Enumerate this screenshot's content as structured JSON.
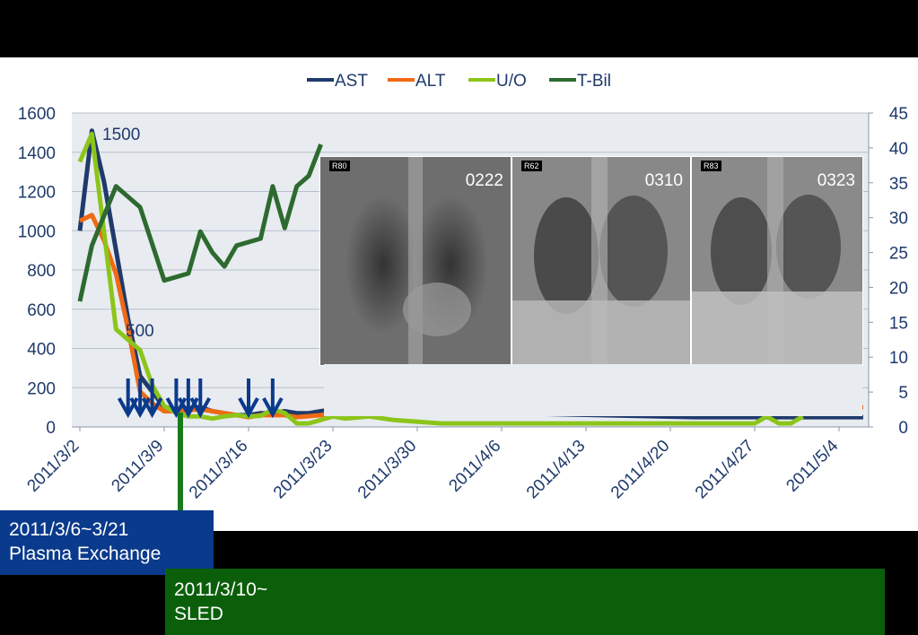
{
  "chart_data": {
    "type": "line",
    "legend": {
      "position": "top",
      "entries": [
        "AST",
        "ALT",
        "U/O",
        "T-Bil"
      ]
    },
    "colors": {
      "AST": "#1f3a6b",
      "ALT": "#f06a14",
      "U/O": "#8cc51a",
      "T-Bil": "#2d6a2f"
    },
    "x_ticks": [
      "2011/3/2",
      "2011/3/9",
      "2011/3/16",
      "2011/3/23",
      "2011/3/30",
      "2011/4/6",
      "2011/4/13",
      "2011/4/20",
      "2011/4/27",
      "2011/5/4"
    ],
    "y_left_ticks": [
      "0",
      "200",
      "400",
      "600",
      "800",
      "1000",
      "1200",
      "1400",
      "1600"
    ],
    "y_right_ticks": [
      "0",
      "5",
      "10",
      "15",
      "20",
      "25",
      "30",
      "35",
      "40",
      "45"
    ],
    "ylim_left": [
      0,
      1600
    ],
    "ylim_right": [
      0,
      45
    ],
    "grid": true,
    "series": [
      {
        "name": "AST",
        "axis": "left",
        "x": [
          "2011/3/2",
          "2011/3/3",
          "2011/3/4",
          "2011/3/5",
          "2011/3/6",
          "2011/3/7",
          "2011/3/8",
          "2011/3/9",
          "2011/3/10",
          "2011/3/11",
          "2011/3/12",
          "2011/3/13",
          "2011/3/14",
          "2011/3/15",
          "2011/3/16",
          "2011/3/17",
          "2011/3/18",
          "2011/3/19",
          "2011/3/20",
          "2011/3/21",
          "2011/3/22",
          "2011/3/23",
          "2011/4/22",
          "2011/5/6"
        ],
        "y": [
          1000,
          1510,
          1250,
          900,
          550,
          260,
          180,
          100,
          90,
          95,
          100,
          80,
          70,
          60,
          60,
          70,
          70,
          80,
          70,
          70,
          80,
          90,
          50,
          50
        ]
      },
      {
        "name": "ALT",
        "axis": "left",
        "x": [
          "2011/3/2",
          "2011/3/3",
          "2011/3/4",
          "2011/3/5",
          "2011/3/6",
          "2011/3/7",
          "2011/3/8",
          "2011/3/9",
          "2011/3/10",
          "2011/3/11",
          "2011/3/12",
          "2011/3/13",
          "2011/3/14",
          "2011/3/15",
          "2011/3/16",
          "2011/3/17",
          "2011/3/18",
          "2011/3/19",
          "2011/3/20",
          "2011/3/21",
          "2011/3/22",
          "2011/3/23",
          "2011/5/6"
        ],
        "y": [
          1050,
          1080,
          950,
          780,
          500,
          180,
          120,
          80,
          80,
          85,
          90,
          80,
          70,
          60,
          50,
          60,
          60,
          60,
          50,
          55,
          60,
          70,
          100
        ]
      },
      {
        "name": "U/O",
        "axis": "right",
        "x": [
          "2011/3/2",
          "2011/3/3",
          "2011/3/4",
          "2011/3/5",
          "2011/3/6",
          "2011/3/7",
          "2011/3/8",
          "2011/3/9",
          "2011/3/10",
          "2011/3/11",
          "2011/3/12",
          "2011/3/13",
          "2011/3/14",
          "2011/3/15",
          "2011/3/16",
          "2011/3/17",
          "2011/3/18",
          "2011/3/19",
          "2011/3/20",
          "2011/3/21",
          "2011/3/22",
          "2011/3/23",
          "2011/3/24",
          "2011/3/26",
          "2011/3/28",
          "2011/4/1",
          "2011/4/6",
          "2011/4/27",
          "2011/4/28",
          "2011/4/29",
          "2011/4/30",
          "2011/5/1"
        ],
        "y": [
          38,
          42,
          28,
          14,
          12.5,
          11,
          6,
          3,
          2,
          1.5,
          1.5,
          1.2,
          1.5,
          1.7,
          1.5,
          1.6,
          2.5,
          2,
          0.5,
          0.5,
          1,
          1.5,
          1.2,
          1.5,
          1,
          0.5,
          0.5,
          0.5,
          1.5,
          0.5,
          0.5,
          1.5
        ]
      },
      {
        "name": "T-Bil",
        "axis": "right",
        "x": [
          "2011/3/2",
          "2011/3/3",
          "2011/3/5",
          "2011/3/7",
          "2011/3/9",
          "2011/3/10",
          "2011/3/11",
          "2011/3/12",
          "2011/3/13",
          "2011/3/14",
          "2011/3/15",
          "2011/3/17",
          "2011/3/18",
          "2011/3/19",
          "2011/3/20",
          "2011/3/21",
          "2011/3/22"
        ],
        "y": [
          18,
          26,
          34.5,
          31.5,
          21,
          21.5,
          22,
          28,
          25,
          23,
          26,
          27,
          34.5,
          28.5,
          34.5,
          36,
          40.5
        ]
      }
    ],
    "annotations": [
      "1500",
      "500"
    ],
    "arrows": [
      "2011/3/6",
      "2011/3/7",
      "2011/3/8",
      "2011/3/10",
      "2011/3/11",
      "2011/3/12",
      "2011/3/16",
      "2011/3/18"
    ]
  },
  "xray_images": [
    {
      "label": "0222",
      "marker": "R80"
    },
    {
      "label": "0310",
      "marker": "R62"
    },
    {
      "label": "0323",
      "marker": "R83"
    }
  ],
  "boxes": {
    "plasma_exchange": {
      "line1": "2011/3/6~3/21",
      "line2": "Plasma Exchange"
    },
    "sled": {
      "line1": "2011/3/10~",
      "line2": "SLED"
    }
  }
}
